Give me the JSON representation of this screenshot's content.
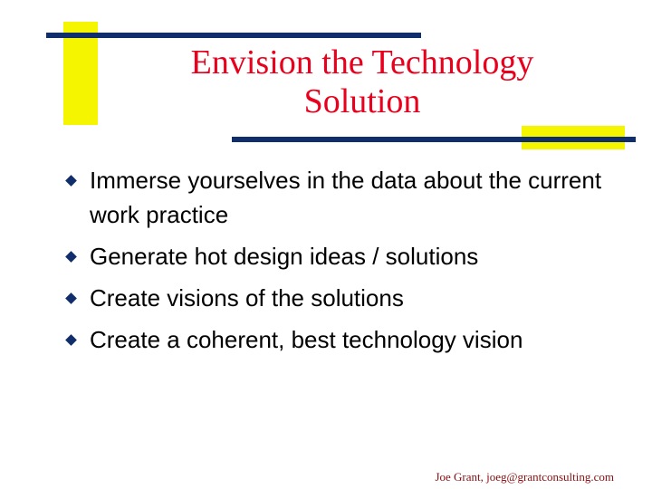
{
  "slide": {
    "title_line1": "Envision the Technology",
    "title_line2": "Solution",
    "bullets": [
      "Immerse yourselves in the data about the current work practice",
      "Generate hot design ideas / solutions",
      "Create visions of the solutions",
      "Create a coherent, best technology vision"
    ],
    "footer": "Joe Grant, joeg@grantconsulting.com"
  },
  "colors": {
    "title": "#e8001c",
    "bars": "#0f2e6b",
    "accent": "#f5f500",
    "footer": "#8a0e12"
  },
  "icons": {
    "bullet": "diamond-bullet-icon"
  }
}
